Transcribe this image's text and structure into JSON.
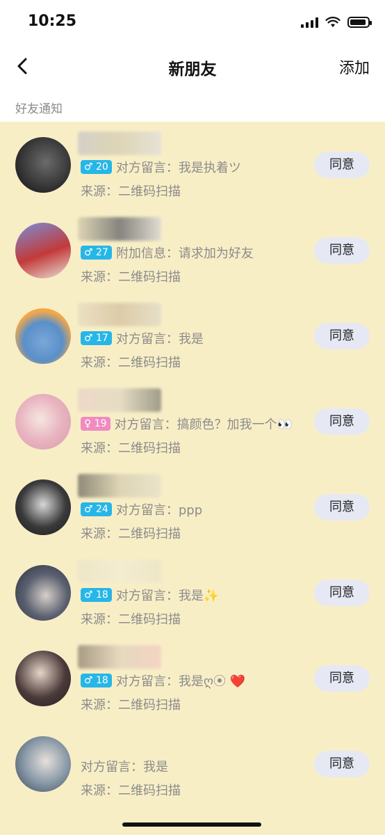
{
  "status_bar": {
    "time": "10:25"
  },
  "nav": {
    "title": "新朋友",
    "add_label": "添加"
  },
  "section": {
    "title": "好友通知"
  },
  "colors": {
    "male_badge": "#27b6e8",
    "female_badge": "#f08bc0",
    "agree_bg": "#e6e8f4",
    "list_bg": "#f8eec6"
  },
  "requests": [
    {
      "gender_symbol": "♂",
      "age": "20",
      "message": "对方留言：我是执着ツ",
      "source": "来源：二维码扫描",
      "agree_label": "同意"
    },
    {
      "gender_symbol": "♂",
      "age": "27",
      "message": "附加信息：请求加为好友",
      "source": "来源：二维码扫描",
      "agree_label": "同意"
    },
    {
      "gender_symbol": "♂",
      "age": "17",
      "message": "对方留言：我是",
      "source": "来源：二维码扫描",
      "agree_label": "同意"
    },
    {
      "gender_symbol": "♀",
      "age": "19",
      "message": "对方留言：搞颜色？加我一个👀",
      "source": "来源：二维码扫描",
      "agree_label": "同意"
    },
    {
      "gender_symbol": "♂",
      "age": "24",
      "message": "对方留言：ppp",
      "source": "来源：二维码扫描",
      "agree_label": "同意"
    },
    {
      "gender_symbol": "♂",
      "age": "18",
      "message": "对方留言：我是✨",
      "source": "来源：二维码扫描",
      "agree_label": "同意"
    },
    {
      "gender_symbol": "♂",
      "age": "18",
      "message": "对方留言：我是ღ⦿ ❤️",
      "source": "来源：二维码扫描",
      "agree_label": "同意"
    },
    {
      "gender_symbol": "",
      "age": "",
      "message": "对方留言：我是",
      "source": "来源：二维码扫描",
      "agree_label": "同意"
    }
  ]
}
